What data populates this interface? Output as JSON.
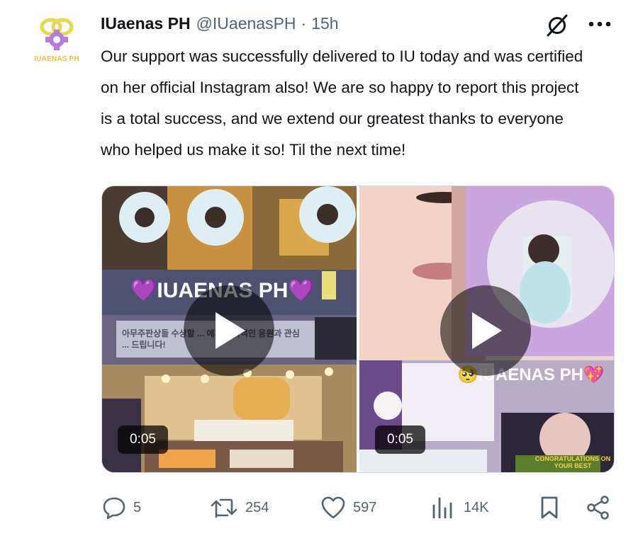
{
  "tweet": {
    "avatar_text": "IUAENAS PH",
    "display_name": "IUaenas PH",
    "handle": "@IUaenasPH",
    "separator": "·",
    "time": "15h",
    "text": "Our support was successfully delivered to IU today and was certified\non her official Instagram also! We are so happy to report this project\nis a total success, and we extend our greatest thanks to everyone\nwho helped us make it so! Til the next time!"
  },
  "media": {
    "videos": [
      {
        "duration": "0:05",
        "overlay_text": "💜IUAENAS PH💜",
        "banner_text": "아무주판상들 수상할 ... 에게 지속적인 응원과 관심 ... 드립니다!"
      },
      {
        "duration": "0:05",
        "overlay_text": "🥺IUAENAS PH💖",
        "badge_text": "CONGRATULATIONS ON YOUR BEST"
      }
    ]
  },
  "actions": {
    "replies": "5",
    "reposts": "254",
    "likes": "597",
    "views": "14K"
  },
  "icons": {
    "reply": "reply-icon",
    "repost": "repost-icon",
    "like": "heart-icon",
    "views": "views-chart-icon",
    "bookmark": "bookmark-icon",
    "share": "share-icon",
    "grok": "grok-icon",
    "more": "more-icon"
  },
  "colors": {
    "text": "#0f1419",
    "secondary": "#536471",
    "brand_purple": "#9b59d0",
    "brand_yellow": "#e9d64a"
  }
}
